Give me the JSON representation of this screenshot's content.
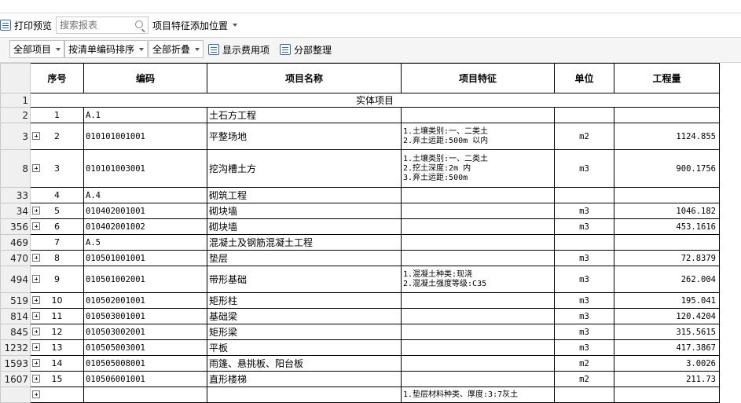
{
  "toolbar1": {
    "print_preview_label": "打印预览",
    "search_placeholder": "搜索报表",
    "feature_position_label": "项目特征添加位置"
  },
  "toolbar2": {
    "all_items_label": "全部项目",
    "sort_label": "按清单编码排序",
    "collapse_label": "全部折叠",
    "show_fees_label": "显示费用项",
    "organize_label": "分部整理"
  },
  "table": {
    "headers": {
      "seq": "序号",
      "code": "编码",
      "name": "项目名称",
      "feature": "项目特征",
      "unit": "单位",
      "qty": "工程量"
    },
    "rows": [
      {
        "row": "1",
        "type": "section",
        "text": "实体项目"
      },
      {
        "row": "2",
        "type": "group",
        "seq": "1",
        "code": "A.1",
        "name": "土石方工程"
      },
      {
        "row": "3",
        "type": "item",
        "seq": "2",
        "code": "010101001001",
        "name": "平整场地",
        "feature": [
          "1.土壤类别:一、二类土",
          "2.弃土运距:500m 以内"
        ],
        "unit": "m2",
        "qty": "1124.855"
      },
      {
        "row": "8",
        "type": "item",
        "seq": "3",
        "code": "010101003001",
        "name": "挖沟槽土方",
        "feature": [
          "1.土壤类别:一、二类土",
          "2.挖土深度:2m 内",
          "3.弃土运距:500m"
        ],
        "unit": "m3",
        "qty": "900.1756"
      },
      {
        "row": "33",
        "type": "group",
        "seq": "4",
        "code": "A.4",
        "name": "砌筑工程"
      },
      {
        "row": "34",
        "type": "item",
        "seq": "5",
        "code": "010402001001",
        "name": "砌块墙",
        "feature": [],
        "unit": "m3",
        "qty": "1046.182"
      },
      {
        "row": "356",
        "type": "item",
        "seq": "6",
        "code": "010402001002",
        "name": "砌块墙",
        "feature": [],
        "unit": "m3",
        "qty": "453.1616"
      },
      {
        "row": "469",
        "type": "group",
        "seq": "7",
        "code": "A.5",
        "name": "混凝土及钢筋混凝土工程"
      },
      {
        "row": "470",
        "type": "item",
        "seq": "8",
        "code": "010501001001",
        "name": "垫层",
        "feature": [],
        "unit": "m3",
        "qty": "72.8379"
      },
      {
        "row": "494",
        "type": "item",
        "seq": "9",
        "code": "010501002001",
        "name": "带形基础",
        "feature": [
          "1.混凝土种类:现浇",
          "2.混凝土强度等级:C35"
        ],
        "unit": "m3",
        "qty": "262.004"
      },
      {
        "row": "519",
        "type": "item",
        "seq": "10",
        "code": "010502001001",
        "name": "矩形柱",
        "feature": [],
        "unit": "m3",
        "qty": "195.041"
      },
      {
        "row": "814",
        "type": "item",
        "seq": "11",
        "code": "010503001001",
        "name": "基础梁",
        "feature": [],
        "unit": "m3",
        "qty": "120.4204"
      },
      {
        "row": "845",
        "type": "item",
        "seq": "12",
        "code": "010503002001",
        "name": "矩形梁",
        "feature": [],
        "unit": "m3",
        "qty": "315.5615"
      },
      {
        "row": "1232",
        "type": "item",
        "seq": "13",
        "code": "010505003001",
        "name": "平板",
        "feature": [],
        "unit": "m3",
        "qty": "417.3867"
      },
      {
        "row": "1593",
        "type": "item",
        "seq": "14",
        "code": "010505008001",
        "name": "雨篷、悬挑板、阳台板",
        "feature": [],
        "unit": "m2",
        "qty": "3.0026"
      },
      {
        "row": "1607",
        "type": "item",
        "seq": "15",
        "code": "010506001001",
        "name": "直形楼梯",
        "feature": [],
        "unit": "m2",
        "qty": "211.73"
      },
      {
        "row": "",
        "type": "item",
        "seq": "",
        "code": "",
        "name": "",
        "feature": [
          "1.垫层材料种类、厚度:3:7灰土"
        ],
        "unit": "",
        "qty": ""
      }
    ]
  }
}
